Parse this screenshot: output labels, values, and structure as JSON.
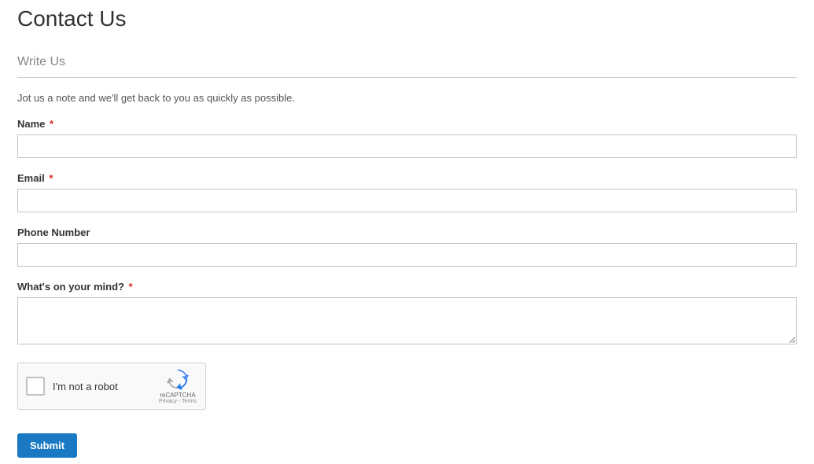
{
  "pageTitle": "Contact Us",
  "sectionTitle": "Write Us",
  "introText": "Jot us a note and we'll get back to you as quickly as possible.",
  "requiredMark": "*",
  "fields": {
    "name": {
      "label": "Name",
      "required": true
    },
    "email": {
      "label": "Email",
      "required": true
    },
    "phone": {
      "label": "Phone Number",
      "required": false
    },
    "comment": {
      "label": "What's on your mind?",
      "required": true
    }
  },
  "recaptcha": {
    "label": "I'm not a robot",
    "brand": "reCAPTCHA",
    "links": "Privacy - Terms"
  },
  "submitLabel": "Submit"
}
